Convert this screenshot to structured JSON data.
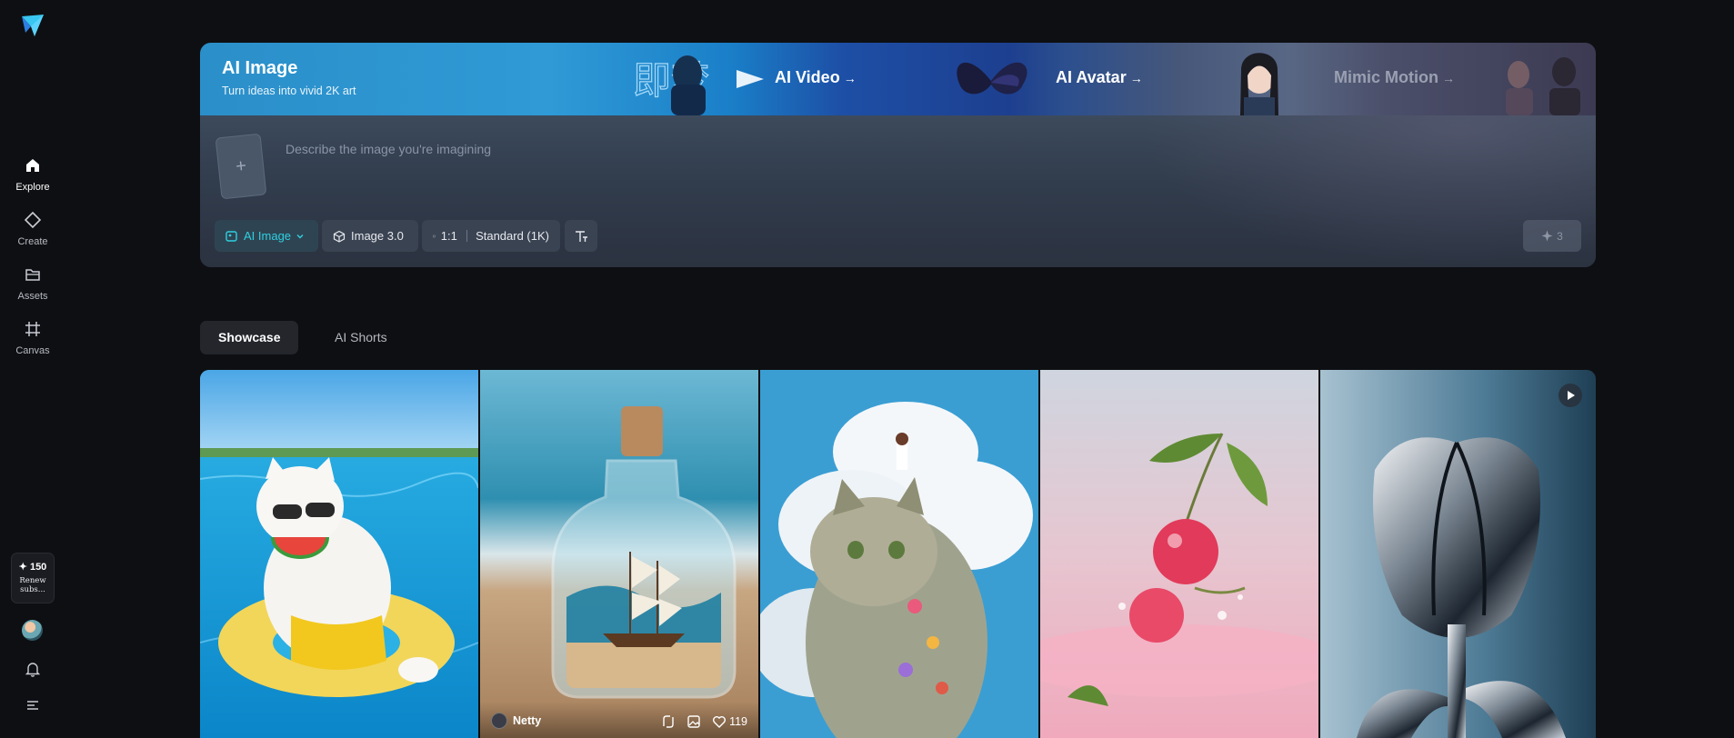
{
  "sidebar": {
    "items": [
      {
        "label": "Explore",
        "icon": "home-icon",
        "active": true
      },
      {
        "label": "Create",
        "icon": "diamond-icon",
        "active": false
      },
      {
        "label": "Assets",
        "icon": "folder-icon",
        "active": false
      },
      {
        "label": "Canvas",
        "icon": "canvas-icon",
        "active": false
      }
    ],
    "credits": "✦ 150",
    "credits_note": "Renew subs..."
  },
  "hero": {
    "title": "AI Image",
    "subtitle": "Turn ideas into vivid 2K art",
    "links": [
      {
        "label": "AI Video",
        "arrow": "→"
      },
      {
        "label": "AI Avatar",
        "arrow": "→"
      },
      {
        "label": "Mimic Motion",
        "arrow": "→"
      }
    ],
    "deco_text": "即梦",
    "prompt_placeholder": "Describe the image you're imagining",
    "upload_plus": "+",
    "mode_label": "AI Image",
    "model_label": "Image 3.0",
    "ratio_label": "1:1",
    "quality_label": "Standard (1K)",
    "generate_cost": "3",
    "accent_color": "#2fd0e0"
  },
  "tabs": [
    {
      "label": "Showcase",
      "active": true
    },
    {
      "label": "AI Shorts",
      "active": false
    }
  ],
  "showcase": {
    "cards": [
      {
        "subject": "white cat with watermelon in pool"
      },
      {
        "subject": "ship in a bottle on the beach",
        "author": "Netty",
        "likes": "119"
      },
      {
        "subject": "calico cat under clouds with flowers"
      },
      {
        "subject": "cherries splashing into pink water"
      },
      {
        "subject": "chrome metallic tulip"
      }
    ]
  }
}
